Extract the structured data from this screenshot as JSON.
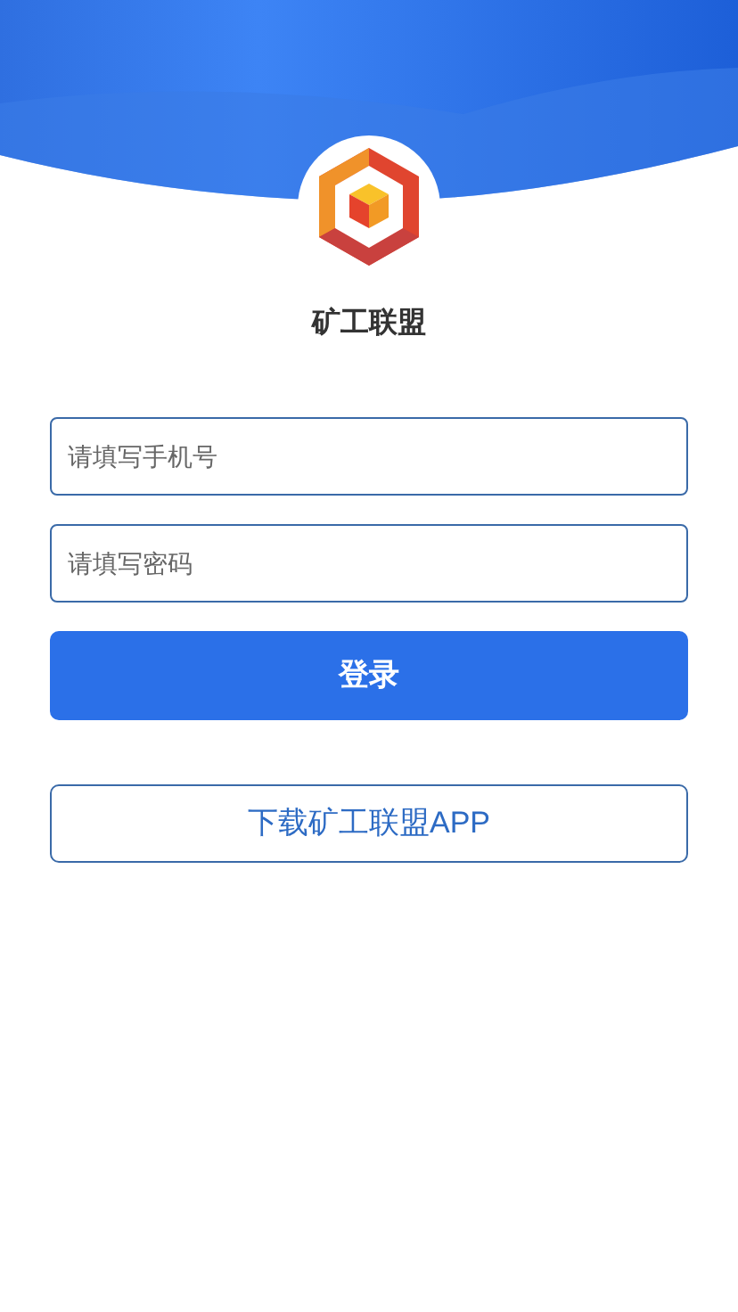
{
  "app_name": "矿工联盟",
  "fields": [
    {
      "placeholder": "请填写手机号"
    },
    {
      "placeholder": "请填写密码"
    }
  ],
  "login_button": "登录",
  "download_button": "下载矿工联盟APP"
}
